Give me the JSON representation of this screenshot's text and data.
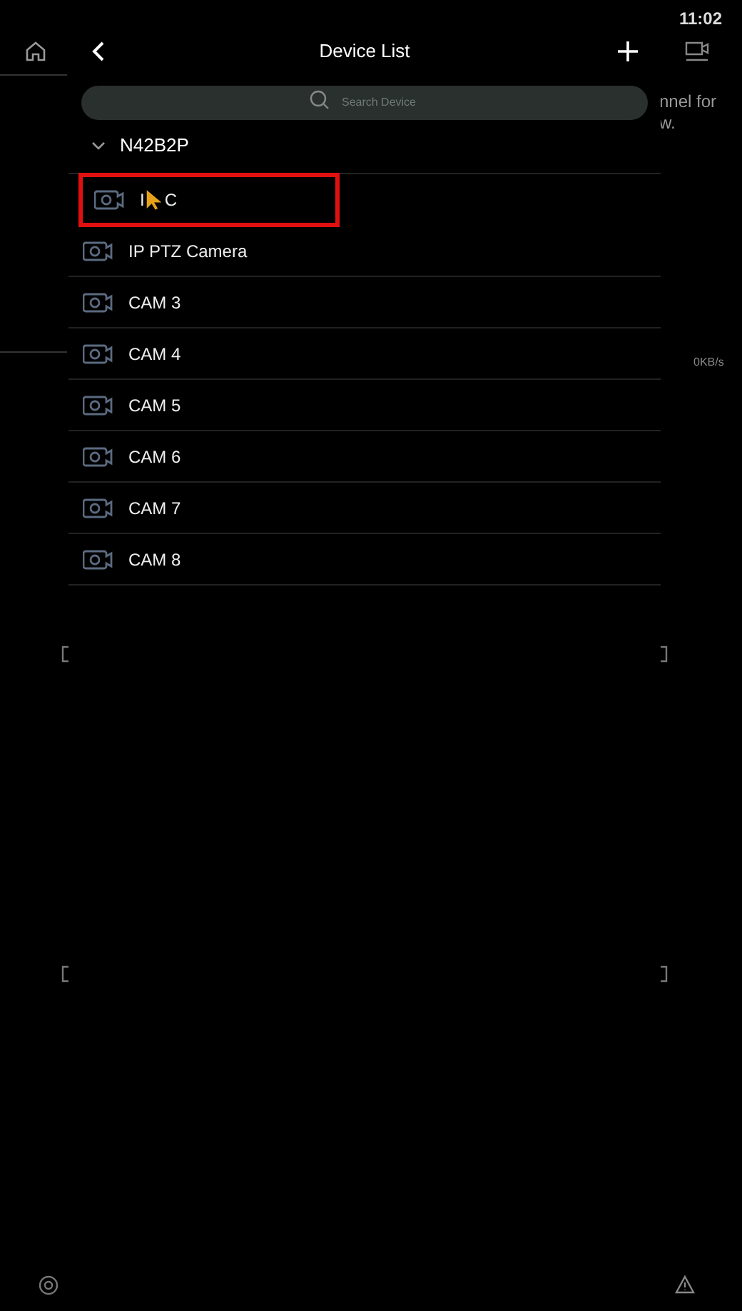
{
  "status_bar": {
    "time": "11:02"
  },
  "background": {
    "texts": [
      "nnel for",
      "w."
    ],
    "speed": "0KB/s"
  },
  "panel": {
    "title": "Device List",
    "search": {
      "placeholder": "Search Device"
    },
    "group": {
      "name": "N42B2P",
      "expanded": true,
      "devices": [
        {
          "name_parts": [
            "I",
            "C"
          ],
          "selected": true
        },
        {
          "name": "IP PTZ Camera",
          "selected": false
        },
        {
          "name": "CAM 3",
          "selected": false
        },
        {
          "name": "CAM 4",
          "selected": false
        },
        {
          "name": "CAM 5",
          "selected": false
        },
        {
          "name": "CAM 6",
          "selected": false
        },
        {
          "name": "CAM 7",
          "selected": false
        },
        {
          "name": "CAM 8",
          "selected": false
        }
      ]
    }
  }
}
